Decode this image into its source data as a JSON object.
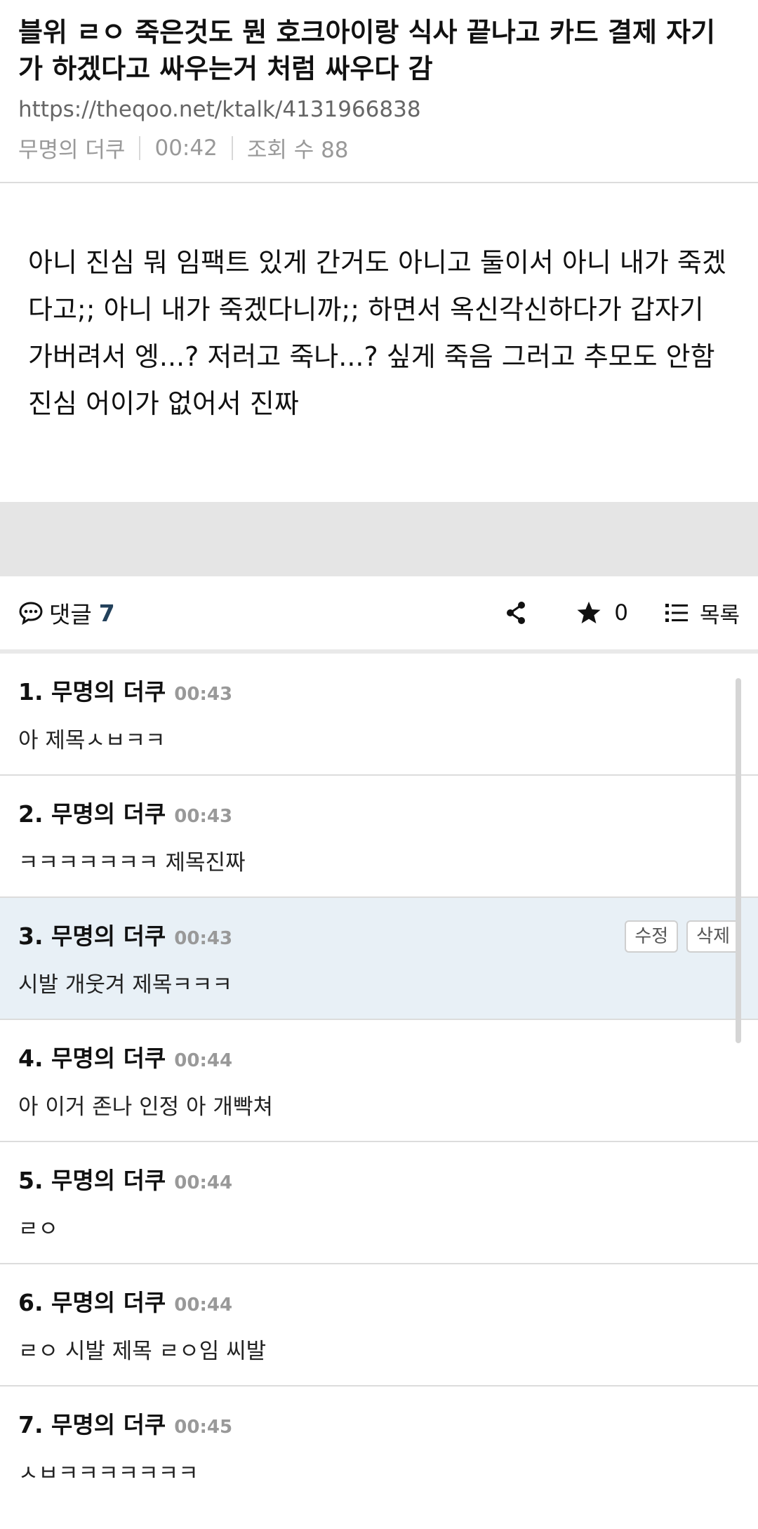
{
  "post": {
    "title": "블위 ㄹㅇ 죽은것도 뭔 호크아이랑 식사 끝나고 카드 결제 자기가 하겠다고 싸우는거 처럼 싸우다 감",
    "url": "https://theqoo.net/ktalk/4131966838",
    "author": "무명의 더쿠",
    "time": "00:42",
    "views": "조회 수 88",
    "body": "아니 진심 뭐 임팩트 있게 간거도 아니고 둘이서 아니 내가 죽겠다고;; 아니 내가 죽겠다니까;; 하면서 옥신각신하다가 갑자기 가버려서 엥...? 저러고 죽나...? 싶게 죽음 그러고 추모도 안함 진심 어이가 없어서 진짜"
  },
  "comment_bar": {
    "label": "댓글",
    "count": "7",
    "star_count": "0",
    "list_label": "목록",
    "icons": [
      "chat-bubble-icon",
      "share-icon",
      "star-icon",
      "list-icon"
    ]
  },
  "comments": [
    {
      "num": "1",
      "author": "무명의 더쿠",
      "time": "00:43",
      "text": "아 제목ㅅㅂㅋㅋ"
    },
    {
      "num": "2",
      "author": "무명의 더쿠",
      "time": "00:43",
      "text": "ㅋㅋㅋㅋㅋㅋㅋ 제목진짜"
    },
    {
      "num": "3",
      "author": "무명의 더쿠",
      "time": "00:43",
      "text": "시발 개웃겨 제목ㅋㅋㅋ",
      "edit_label": "수정",
      "delete_label": "삭제"
    },
    {
      "num": "4",
      "author": "무명의 더쿠",
      "time": "00:44",
      "text": "아 이거 존나 인정 아 개빡쳐"
    },
    {
      "num": "5",
      "author": "무명의 더쿠",
      "time": "00:44",
      "text": "ㄹㅇ"
    },
    {
      "num": "6",
      "author": "무명의 더쿠",
      "time": "00:44",
      "text": "ㄹㅇ 시발 제목 ㄹㅇ임 씨발"
    },
    {
      "num": "7",
      "author": "무명의 더쿠",
      "time": "00:45",
      "text": "ㅅㅂㅋㅋㅋㅋㅋㅋㅋ"
    }
  ],
  "colors": {
    "accent_count": "#23415b",
    "highlight_bg": "#e8f0f6",
    "band_gray": "#e5e5e5"
  }
}
